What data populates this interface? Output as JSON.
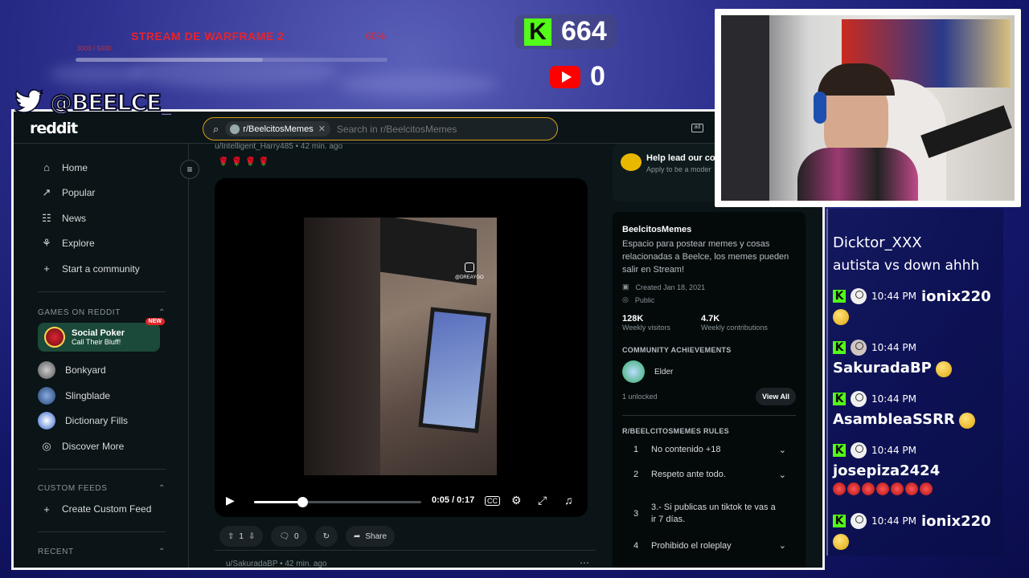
{
  "overlay": {
    "goal_title": "STREAM DE WARFRAME 2",
    "goal_percent": "60%",
    "goal_fraction": 0.6,
    "goal_subtext": "3000 / 5000",
    "kick_count": "664",
    "youtube_count": "0",
    "twitter_handle": "@BEELCE_",
    "kick_glyph": "K"
  },
  "reddit": {
    "logo": "reddit",
    "search": {
      "chip_label": "r/BeelcitosMemes",
      "placeholder": "Search in r/BeelcitosMemes"
    },
    "nav": [
      {
        "label": "Home",
        "icon": "home-icon"
      },
      {
        "label": "Popular",
        "icon": "popular-icon"
      },
      {
        "label": "News",
        "icon": "news-icon"
      },
      {
        "label": "Explore",
        "icon": "explore-icon"
      },
      {
        "label": "Start a community",
        "icon": "plus-icon"
      }
    ],
    "games_header": "GAMES ON REDDIT",
    "featured_game": {
      "title": "Social Poker",
      "subtitle": "Call Their Bluff!",
      "badge": "NEW"
    },
    "games": [
      "Bonkyard",
      "Slingblade",
      "Dictionary Fills",
      "Discover More"
    ],
    "custom_feeds_header": "CUSTOM FEEDS",
    "create_feed": "Create Custom Feed",
    "recent_header": "RECENT",
    "post": {
      "author": "u/Intelligent_Harry485 • 42 min. ago",
      "awards": "🌹 🌹 🌹 🌹",
      "watermark": "@DREAYGO",
      "time": "0:05 / 0:17",
      "progress_fraction": 0.29,
      "upvotes": "1",
      "comments": "0",
      "share": "Share",
      "next_author": "u/SakuradaBP • 42 min. ago"
    },
    "help_card": {
      "title": "Help lead our com",
      "subtitle": "Apply to be a moder"
    },
    "community": {
      "name": "BeelcitosMemes",
      "description": "Espacio para postear memes y cosas relacionadas a Beelce, los memes pueden salir en Stream!",
      "created": "Created Jan 18, 2021",
      "visibility": "Public",
      "weekly_visitors": "128K",
      "weekly_visitors_label": "Weekly visitors",
      "weekly_contributions": "4.7K",
      "weekly_contributions_label": "Weekly contributions",
      "achievements_header": "COMMUNITY ACHIEVEMENTS",
      "achievement": "Elder",
      "unlocked": "1 unlocked",
      "view_all": "View All",
      "rules_header": "R/BEELCITOSMEMES RULES",
      "rules": [
        {
          "n": "1",
          "text": "No contenido +18"
        },
        {
          "n": "2",
          "text": "Respeto ante todo."
        },
        {
          "n": "3",
          "text": "3.- Si publicas un tiktok te vas a ir 7 días."
        },
        {
          "n": "4",
          "text": "Prohibido el roleplay"
        }
      ]
    }
  },
  "chat": [
    {
      "user": "Dicktor_XXX",
      "text": "autista vs down ahhh"
    },
    {
      "time": "10:44 PM",
      "user": "ionix220"
    },
    {
      "time": "10:44 PM",
      "user": "SakuradaBP"
    },
    {
      "time": "10:44 PM",
      "user": "AsambleaSSRR"
    },
    {
      "time": "10:44 PM",
      "user": "josepiza2424"
    },
    {
      "time": "10:44 PM",
      "user": "ionix220"
    }
  ],
  "colors": {
    "kick_green": "#53fc18",
    "goal_red": "#e8232b",
    "reddit_bg": "#0b1416",
    "search_border": "#d4a017"
  }
}
